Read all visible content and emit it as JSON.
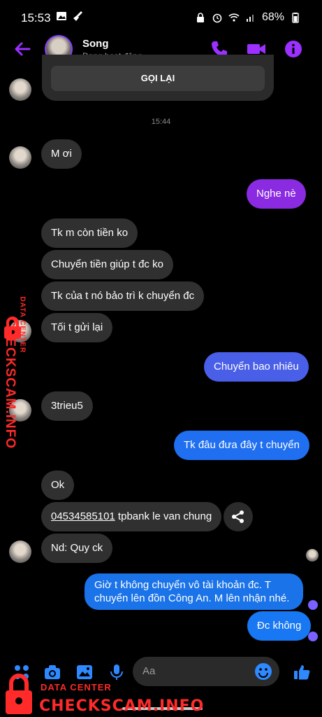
{
  "status_bar": {
    "time": "15:53",
    "battery": "68%",
    "left_icons": [
      "image-icon",
      "broom-icon"
    ],
    "right_icons": [
      "lock-alarm-icon",
      "alarm-icon",
      "wifi-icon",
      "signal-icon",
      "battery-icon"
    ]
  },
  "header": {
    "name": "Song",
    "status": "Đang hoạt động",
    "buttons": [
      "back-arrow-icon",
      "phone-icon",
      "video-icon",
      "info-icon"
    ],
    "accent": "#9b30ff"
  },
  "callback": {
    "label": "GỌI LẠI"
  },
  "timestamp": "15:44",
  "messages": [
    {
      "side": "in",
      "text": "M ơi"
    },
    {
      "side": "out",
      "text": "Nghe nè",
      "color": "#8a2be2"
    },
    {
      "side": "in",
      "text": "Tk m còn tiền ko"
    },
    {
      "side": "in",
      "text": "Chuyển tiền giúp t đc ko"
    },
    {
      "side": "in",
      "text": "Tk của t nó bảo trì k chuyển đc"
    },
    {
      "side": "in",
      "text": "Tối t gửi lại"
    },
    {
      "side": "out",
      "text": "Chuyển bao nhiêu",
      "color": "#4a5fe8"
    },
    {
      "side": "in",
      "text": "3trieu5"
    },
    {
      "side": "out",
      "text": "Tk đâu đưa đây t chuyển",
      "color": "#1f6ff0"
    },
    {
      "side": "in",
      "text": "Ok"
    },
    {
      "side": "in",
      "account": "04534585101",
      "text": " tpbank le van chung"
    },
    {
      "side": "in",
      "text": "Nd: Quy ck"
    },
    {
      "side": "out",
      "text": "Giờ t không chuyển vô tài khoản đc. T chuyển lên đồn Công An. M lên nhận nhé.",
      "color": "#1a73e8"
    },
    {
      "side": "out",
      "text": "Đc không",
      "color": "#1877f2"
    }
  ],
  "compose": {
    "placeholder": "Aa",
    "icons": [
      "menu-dots-icon",
      "camera-icon",
      "gallery-icon",
      "microphone-icon",
      "emoji-icon",
      "thumbs-up-icon"
    ],
    "accent": "#2e89ff"
  },
  "watermark": {
    "small": "DATA CENTER",
    "big": "CHECKSCAM.INFO",
    "color": "#ff2a2a"
  }
}
